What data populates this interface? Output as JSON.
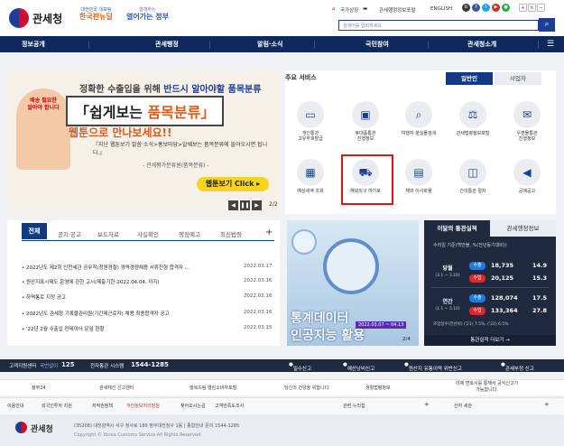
{
  "header": {
    "brand": "관세청",
    "slogan_small_1": "대한민국 대표팀",
    "slogan_big_1": "한국판뉴딜",
    "slogan_small_2": "함께하는",
    "slogan_big_2": "열어가는 정부",
    "util_links": [
      "국가상징",
      "관세행정정보포털",
      "ENGLISH"
    ],
    "search_placeholder": "검색어를 입력하세요"
  },
  "nav": [
    "정보공개",
    "관세행정",
    "알림·소식",
    "국민참여",
    "관세청소개"
  ],
  "banner": {
    "line1_a": "정확한 수출입을 위해 ",
    "line1_b": "반드시 알아야할 품목분류",
    "big_a": "「쉽게보는 ",
    "big_b": "품목분류」",
    "tail": "웹툰으로 만나보세요!!",
    "desc": "『지난 웹툰보기 말씀·소식>홍보마당>알쉐보는 품목분류에 들어오시면 됩니다.』",
    "source": "- 관세평가분류원(품목분류) -",
    "button": "웹툰보기 Click ▸",
    "page": "2/2"
  },
  "services": {
    "title": "주요 서비스",
    "tabs": [
      "일반인",
      "사업자"
    ],
    "items": [
      {
        "label": "개인통관\n고유부호발급",
        "icon": "id-card-icon"
      },
      {
        "label": "휴대품통관\n진행정보",
        "icon": "suitcase-icon"
      },
      {
        "label": "여행자 분실물검색",
        "icon": "search-icon"
      },
      {
        "label": "관세법령정보포털",
        "icon": "gavel-icon"
      },
      {
        "label": "우편물통관\n진행정보",
        "icon": "mail-icon"
      },
      {
        "label": "예상세액 조회",
        "icon": "calculator-icon"
      },
      {
        "label": "해외직구 여기로",
        "icon": "cart-icon"
      },
      {
        "label": "해외 이사화물",
        "icon": "box-icon"
      },
      {
        "label": "간이통관 절차",
        "icon": "bag-icon"
      },
      {
        "label": "공매공고",
        "icon": "bullhorn-icon"
      }
    ]
  },
  "board": {
    "tabs": [
      "전체",
      "공지·공고",
      "보도자료",
      "사실확인",
      "행정예고",
      "최신법령"
    ],
    "rows": [
      {
        "title": "2022년도 제2회 인천세관 공무직(청원경찰) 경력경쟁채용 서류전형 합격자 ...",
        "date": "2022.03.17"
      },
      {
        "title": "원산지표시제도 운영에 관한 고시(제출기한:2022.04.04. 까지)",
        "date": "2022.03.16"
      },
      {
        "title": "하역통로 지정 공고",
        "date": "2022.03.16"
      },
      {
        "title": "2022년도 관세청 기록물관리원(기간제근로자) 채용 최종합격자 공고",
        "date": "2022.03.16"
      },
      {
        "title": "'22년 2월 수출입 컨테이너 운임 현황",
        "date": "2022.03.15"
      }
    ]
  },
  "promo": {
    "line1": "통계데이터",
    "line2": "인공지능 활용",
    "date": "2022.03.07 ~ 04.13",
    "page": "2/4"
  },
  "customs": {
    "tabs": [
      "이달의 통관실적",
      "관세행정정보"
    ],
    "basis": "수리일 기준(백만불, %(전년동기대비))",
    "rows": [
      {
        "label": "당월",
        "period": "(3.1 ~ 3.10)",
        "export": "18,735",
        "export_pct": "14.9",
        "import": "20,125",
        "import_pct": "15.3"
      },
      {
        "label": "연간",
        "period": "(1.1 ~ 3.10)",
        "export": "128,074",
        "export_pct": "17.5",
        "import": "133,364",
        "import_pct": "27.8"
      }
    ],
    "export_chip": "수출",
    "import_chip": "수입",
    "prev_year": "('21) 7.5%, ('22) 6.5%",
    "prev_label": "조업일수(전년비)",
    "more": "통관실적 더보기 →"
  },
  "phone_bar": {
    "label1": "고객지원센터",
    "phone1_prefix": "국번없이",
    "phone1": "125",
    "label2": "전자통관 시스템",
    "phone2": "1544-1285",
    "items": [
      "밀수신고",
      "예산낭비신고",
      "원산지 유통이력 위반신고",
      "관세부정 신고"
    ]
  },
  "links_row1": [
    "정부24",
    "관세체선 신고센터",
    "행복드림 열린소비자포털",
    "당신의 건강을 위합니다.",
    "생활법령정보",
    "이제 변호사를 통해서 공익신고가\n가능합니다."
  ],
  "links_row2": [
    "이용안내",
    "외국인투자 지원",
    "저작권정책",
    "개인정보처리방침",
    "찾아오시는길",
    "고객만족도조사",
    "관련 누리집",
    "산하 세관"
  ],
  "footer": {
    "brand": "관세청",
    "address": "(35208) 대전광역시 서구 청사로 189 정부대전청사 1동   |   종합안내 문의 1544-1285",
    "copyright": "Copyright © Korea Customs Service All Rights Reserved."
  },
  "colors": {
    "navy": "#0e2a5c",
    "accent": "#123a82",
    "highlight": "#d31a1a",
    "export": "#1e7be0",
    "import": "#d92b2b"
  }
}
